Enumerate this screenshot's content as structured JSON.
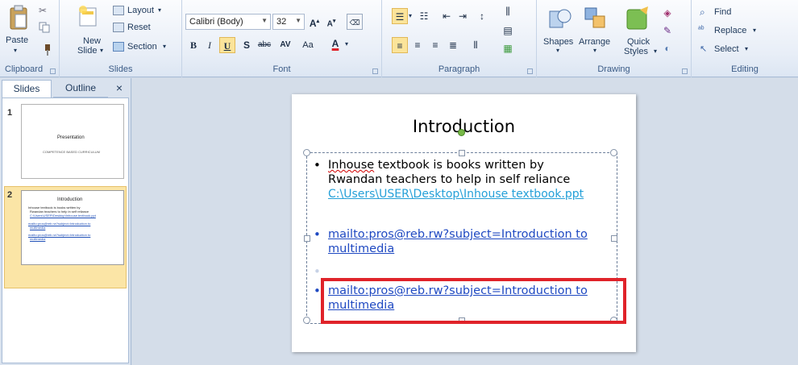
{
  "ribbon": {
    "clipboard": {
      "label": "Clipboard",
      "paste": "Paste"
    },
    "slides": {
      "label": "Slides",
      "new_slide": "New",
      "new_slide2": "Slide",
      "layout": "Layout",
      "reset": "Reset",
      "section": "Section"
    },
    "font": {
      "label": "Font",
      "font_name": "Calibri (Body)",
      "font_size": "32",
      "bold": "B",
      "italic": "I",
      "underline": "U",
      "shadow": "S",
      "strike": "abc",
      "spacing": "AV",
      "case": "Aa",
      "color": "A"
    },
    "paragraph": {
      "label": "Paragraph"
    },
    "drawing": {
      "label": "Drawing",
      "shapes": "Shapes",
      "arrange": "Arrange",
      "quick_styles": "Quick",
      "quick_styles2": "Styles"
    },
    "editing": {
      "label": "Editing",
      "find": "Find",
      "replace": "Replace",
      "select": "Select"
    }
  },
  "left_pane": {
    "tab_slides": "Slides",
    "tab_outline": "Outline",
    "close": "×",
    "thumbs": [
      {
        "number": "1",
        "title": "Presentation",
        "subtitle": "COMPETENCE BASED CURRICULUM"
      },
      {
        "number": "2",
        "title": "Introduction",
        "line1": "Inhouse textbook is books written by",
        "line2": "Rwandan teachers to help in self reliance",
        "line3": "C:\\Users\\USER\\Desktop\\Inhouse textbook.ppt",
        "line4": "mailto:pros@reb.rw?subject=Introduction to",
        "line5": "multimedia",
        "line6": "mailto:pros@reb.rw?subject=Introduction to",
        "line7": "multimedia"
      }
    ]
  },
  "slide": {
    "title": "Introduction",
    "bullet1_line1": "Inhouse textbook is books written by",
    "bullet1_word_misspelled": "Inhouse",
    "bullet1_rest": " textbook is books written by",
    "bullet1_line2": "Rwandan teachers to help in self reliance",
    "bullet1_path": "C:\\Users\\USER\\Desktop\\Inhouse textbook.ppt",
    "bullet2_line1": "mailto:pros@reb.rw?subject=Introduction to",
    "bullet2_line2": "multimedia",
    "bullet3_line1": "mailto:pros@reb.rw?subject=Introduction to",
    "bullet3_line2": "multimedia"
  },
  "colors": {
    "highlight": "#e0232a",
    "link": "#1f49c2",
    "path_link": "#25a0d8"
  }
}
